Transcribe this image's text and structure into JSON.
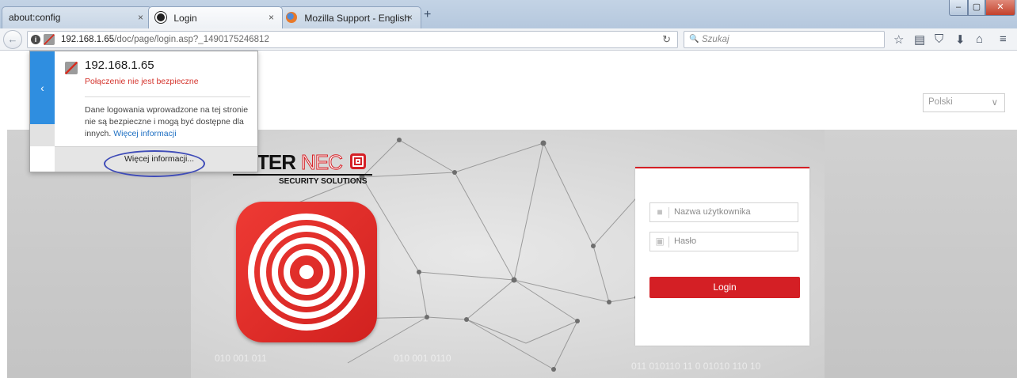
{
  "tabs": [
    {
      "label": "about:config",
      "close": "×"
    },
    {
      "label": "Login",
      "close": "×"
    },
    {
      "label": "Mozilla Support - English",
      "close": "×"
    }
  ],
  "new_tab": "+",
  "window_controls": {
    "minimize": "–",
    "maximize": "▢",
    "close": "✕"
  },
  "navbar": {
    "back_icon": "arrow-left-icon",
    "url_host": "192.168.1.65",
    "url_path": "/doc/page/login.asp?_1490175246812",
    "reload": "↻",
    "search_placeholder": "Szukaj",
    "search_icon": "🔍",
    "toolbar_icons": [
      "☆",
      "▤",
      "⛉",
      "⬇",
      "⌂",
      "≡"
    ]
  },
  "popup": {
    "host": "192.168.1.65",
    "warning": "Połączenie nie jest bezpieczne",
    "body": "Dane logowania wprowadzone na tej stronie nie są bezpieczne i mogą być dostępne dla innych.",
    "link": "Więcej informacji",
    "more_button": "Więcej informacji...",
    "back": "‹"
  },
  "page": {
    "language": "Polski",
    "language_chevron": "∨",
    "logo_text_main": "TER",
    "logo_text_outline": "NEC",
    "logo_subtitle": "SECURITY SOLUTIONS",
    "watermark": "010 001 011",
    "watermark2": "010 001 0110",
    "watermark3": "011 010110 11 0 01010 110 10",
    "username_placeholder": "Nazwa użytkownika",
    "password_placeholder": "Hasło",
    "login_button": "Login"
  },
  "colors": {
    "accent": "#d41f25",
    "link": "#1e6fc2",
    "popup_back": "#2f8ee0",
    "circle": "#3f4cb8"
  }
}
